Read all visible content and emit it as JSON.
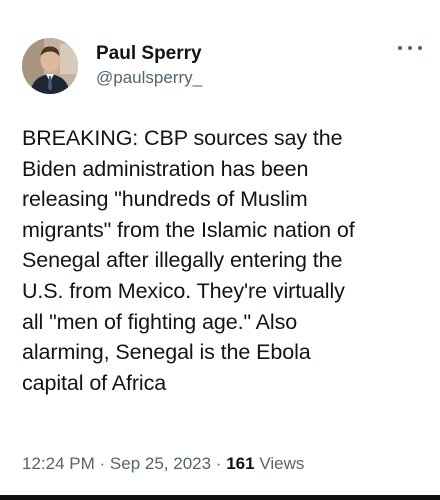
{
  "author": {
    "display_name": "Paul Sperry",
    "handle": "@paulsperry_",
    "avatar_icon": "profile-photo-avatar"
  },
  "tweet": {
    "text": "BREAKING: CBP sources say the\nBiden administration has been\nreleasing \"hundreds of Muslim\nmigrants\" from the Islamic nation of\nSenegal after illegally entering the\nU.S. from Mexico. They're virtually\nall \"men of fighting age.\" Also\nalarming, Senegal is the Ebola\ncapital of Africa"
  },
  "meta": {
    "time": "12:24 PM",
    "separator": "·",
    "date": "Sep 25, 2023",
    "views_count": "161",
    "views_label": "Views"
  },
  "icons": {
    "more": "more-options-icon"
  },
  "colors": {
    "text_primary": "#0f1419",
    "text_secondary": "#536471",
    "background": "#ffffff"
  }
}
